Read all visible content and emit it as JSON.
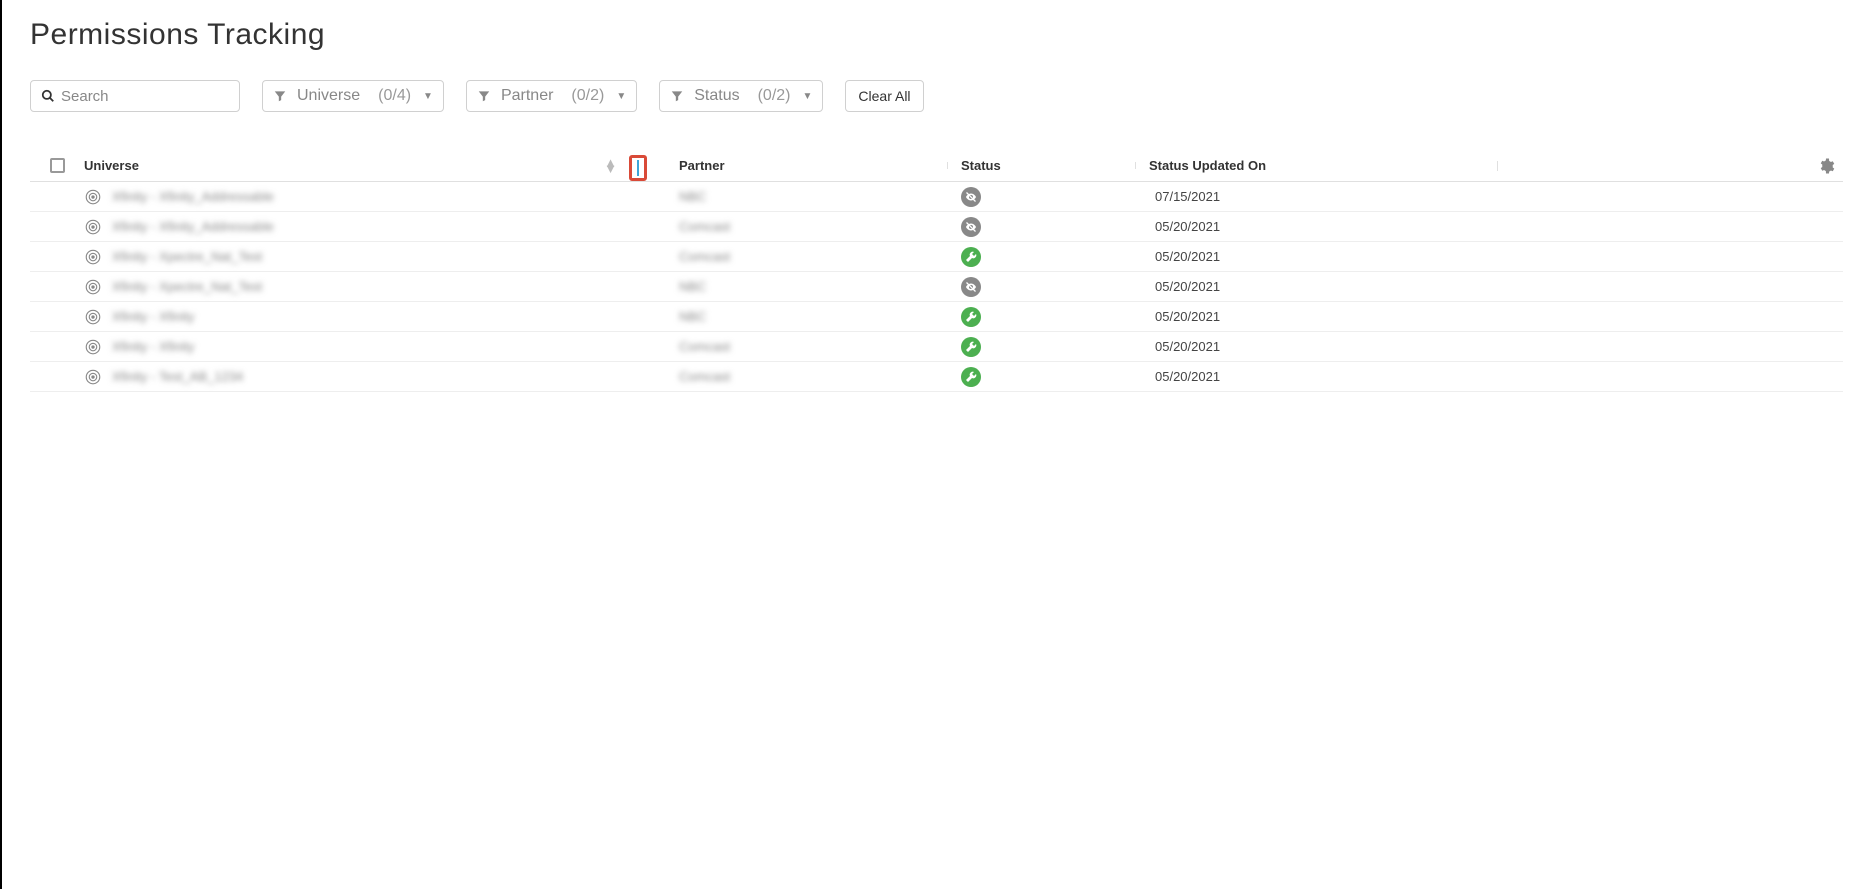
{
  "page": {
    "title": "Permissions Tracking"
  },
  "search": {
    "placeholder": "Search"
  },
  "filters": {
    "universe": {
      "label": "Universe",
      "count": "(0/4)"
    },
    "partner": {
      "label": "Partner",
      "count": "(0/2)"
    },
    "status": {
      "label": "Status",
      "count": "(0/2)"
    },
    "clear": "Clear All"
  },
  "columns": {
    "universe": "Universe",
    "partner": "Partner",
    "status": "Status",
    "updated": "Status Updated On"
  },
  "rows": [
    {
      "universe": "Xfinity - Xfinity_Addressable",
      "partner": "NBC",
      "status": "disabled",
      "updated": "07/15/2021"
    },
    {
      "universe": "Xfinity - Xfinity_Addressable",
      "partner": "Comcast",
      "status": "disabled",
      "updated": "05/20/2021"
    },
    {
      "universe": "Xfinity - Xpectre_Nat_Test",
      "partner": "Comcast",
      "status": "enabled",
      "updated": "05/20/2021"
    },
    {
      "universe": "Xfinity - Xpectre_Nat_Test",
      "partner": "NBC",
      "status": "disabled",
      "updated": "05/20/2021"
    },
    {
      "universe": "Xfinity - Xfinity",
      "partner": "NBC",
      "status": "enabled",
      "updated": "05/20/2021"
    },
    {
      "universe": "Xfinity - Xfinity",
      "partner": "Comcast",
      "status": "enabled",
      "updated": "05/20/2021"
    },
    {
      "universe": "Xfinity - Test_AB_1234",
      "partner": "Comcast",
      "status": "enabled",
      "updated": "05/20/2021"
    }
  ]
}
